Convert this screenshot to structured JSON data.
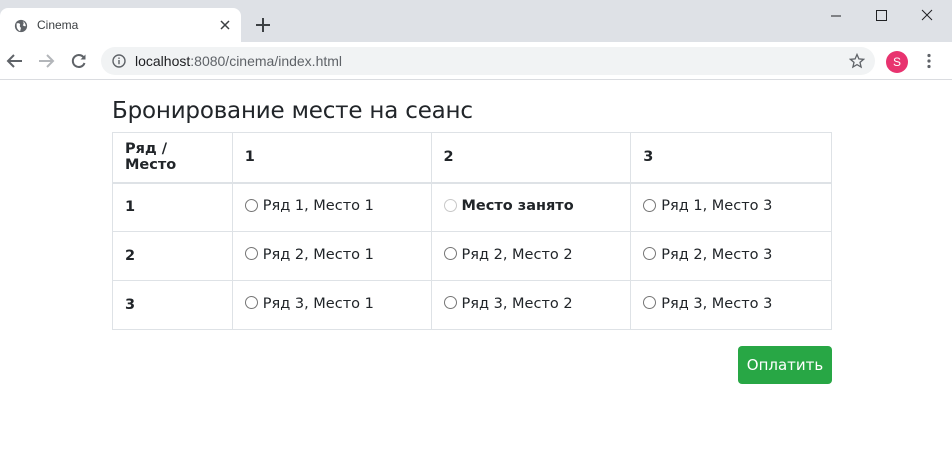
{
  "browser": {
    "tab": {
      "title": "Cinema"
    },
    "address": {
      "host": "localhost",
      "path": ":8080/cinema/index.html"
    },
    "profile_initial": "S"
  },
  "page": {
    "title": "Бронирование месте на сеанс",
    "table": {
      "headers": [
        "Ряд / Место",
        "1",
        "2",
        "3"
      ],
      "rows": [
        {
          "row": "1",
          "seats": [
            {
              "label": "Ряд 1, Место 1",
              "occupied": false
            },
            {
              "label": "Место занято",
              "occupied": true
            },
            {
              "label": "Ряд 1, Место 3",
              "occupied": false
            }
          ]
        },
        {
          "row": "2",
          "seats": [
            {
              "label": "Ряд 2, Место 1",
              "occupied": false
            },
            {
              "label": "Ряд 2, Место 2",
              "occupied": false
            },
            {
              "label": "Ряд 2, Место 3",
              "occupied": false
            }
          ]
        },
        {
          "row": "3",
          "seats": [
            {
              "label": "Ряд 3, Место 1",
              "occupied": false
            },
            {
              "label": "Ряд 3, Место 2",
              "occupied": false
            },
            {
              "label": "Ряд 3, Место 3",
              "occupied": false
            }
          ]
        }
      ]
    },
    "pay_button": "Оплатить"
  },
  "colors": {
    "accent": "#28a745",
    "avatar": "#e8336f",
    "border": "#dee2e6"
  },
  "icons": [
    "globe-icon",
    "close-icon",
    "plus-icon",
    "minimize-icon",
    "maximize-icon",
    "window-close-icon",
    "back-arrow-icon",
    "forward-arrow-icon",
    "reload-icon",
    "info-icon",
    "star-icon",
    "kebab-menu-icon"
  ]
}
